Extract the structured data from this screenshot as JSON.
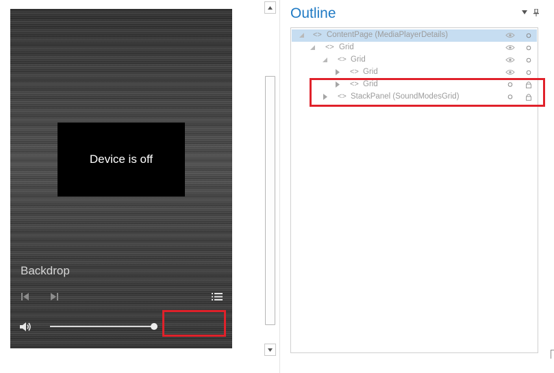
{
  "preview": {
    "device_status": "Device is off",
    "backdrop_label": "Backdrop",
    "icons": [
      "skip-previous-icon",
      "skip-next-icon",
      "playlist-icon",
      "volume-icon"
    ],
    "volume_level": 0.98,
    "highlight_color": "#e0212a"
  },
  "outline": {
    "title": "Outline",
    "title_color": "#1f7ac4",
    "selected_row_color": "#c6ddf1",
    "tag_glyph": "<>",
    "rows": [
      {
        "label": "ContentPage (MediaPlayerDetails)",
        "expander": "expanded",
        "selected": true,
        "visibility": "eye",
        "lock": "circle"
      },
      {
        "label": "Grid",
        "expander": "expanded",
        "selected": false,
        "visibility": "eye",
        "lock": "circle"
      },
      {
        "label": "Grid",
        "expander": "expanded",
        "selected": false,
        "visibility": "eye",
        "lock": "circle"
      },
      {
        "label": "Grid",
        "expander": "collapsed",
        "selected": false,
        "visibility": "eye",
        "lock": "circle"
      },
      {
        "label": "Grid",
        "expander": "collapsed",
        "selected": false,
        "visibility": "circle",
        "lock": "padlock"
      },
      {
        "label": "StackPanel (SoundModesGrid)",
        "expander": "collapsed",
        "selected": false,
        "visibility": "circle",
        "lock": "padlock"
      }
    ]
  }
}
